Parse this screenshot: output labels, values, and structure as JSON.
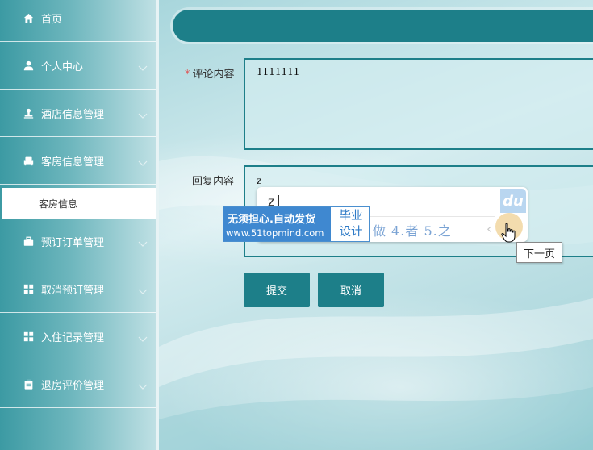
{
  "sidebar": {
    "items": [
      {
        "label": "首页",
        "icon": "home-icon"
      },
      {
        "label": "个人中心",
        "icon": "user-icon"
      },
      {
        "label": "酒店信息管理",
        "icon": "stamp-icon"
      },
      {
        "label": "客房信息管理",
        "icon": "bed-icon"
      },
      {
        "label": "预订订单管理",
        "icon": "briefcase-icon"
      },
      {
        "label": "取消预订管理",
        "icon": "grid-icon"
      },
      {
        "label": "入住记录管理",
        "icon": "grid-icon"
      },
      {
        "label": "退房评价管理",
        "icon": "clipboard-icon"
      }
    ],
    "active_subitem": "客房信息"
  },
  "form": {
    "comment_label": "评论内容",
    "comment_required_mark": "*",
    "comment_value": "1111111",
    "reply_label": "回复内容",
    "reply_value": "z"
  },
  "buttons": {
    "submit": "提交",
    "cancel": "取消"
  },
  "ime": {
    "composition": "z",
    "logo": "du",
    "candidates": "做 4.者 5.之",
    "prev_arrow": "‹",
    "tooltip": "下一页"
  },
  "ad": {
    "line1": "无须担心.自动发货",
    "line2": "www.51topmind.com",
    "right_line1": "毕业",
    "right_line2": "设计"
  },
  "colors": {
    "accent": "#1d7f89",
    "sidebar_start": "#3c9aa3",
    "ad_blue": "#3f88d0"
  }
}
